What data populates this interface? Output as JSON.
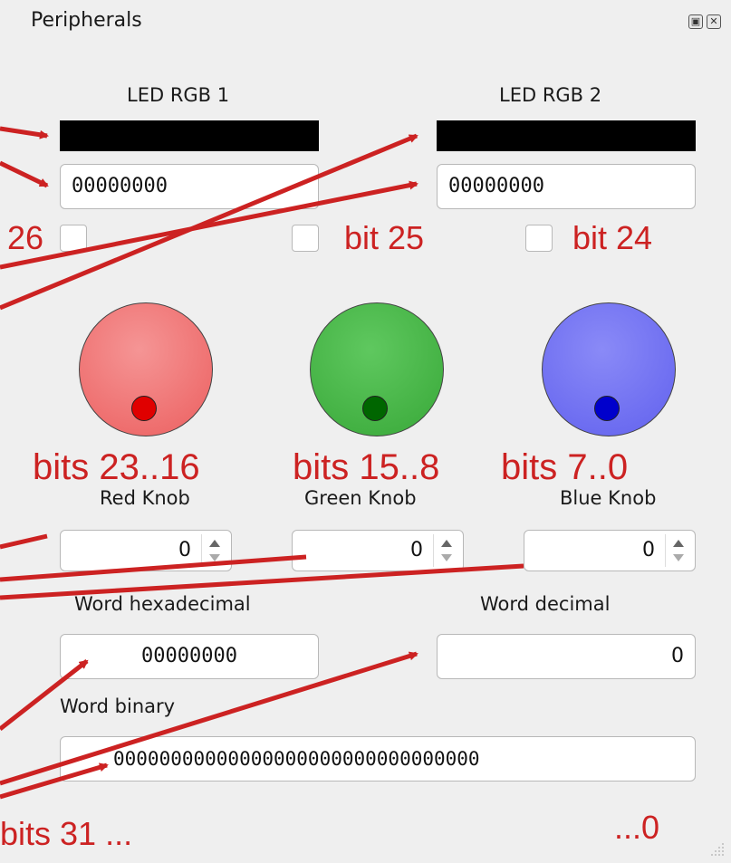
{
  "window": {
    "title": "Peripherals",
    "float_icon": "float-icon",
    "close_icon": "close-icon"
  },
  "leds": [
    {
      "label": "LED RGB 1",
      "value": "00000000",
      "color": "#000000"
    },
    {
      "label": "LED RGB 2",
      "value": "00000000",
      "color": "#000000"
    }
  ],
  "bit_annotations": {
    "bit26": "26",
    "bit25": "bit 25",
    "bit24": "bit 24"
  },
  "knobs": [
    {
      "annotation": "bits 23..16",
      "label": "Red Knob",
      "value": "0",
      "color": "#f26c6c",
      "dot": "#e00000"
    },
    {
      "annotation": "bits 15..8",
      "label": "Green Knob",
      "value": "0",
      "color": "#3fb03f",
      "dot": "#006600"
    },
    {
      "annotation": "bits 7..0",
      "label": "Blue Knob",
      "value": "0",
      "color": "#6f6ff2",
      "dot": "#0000cc"
    }
  ],
  "word": {
    "hex_label": "Word hexadecimal",
    "hex_value": "00000000",
    "dec_label": "Word decimal",
    "dec_value": "0",
    "bin_label": "Word binary",
    "bin_value": "00000000000000000000000000000000"
  },
  "footer_annotations": {
    "left": "bits  31 ...",
    "right": "...0"
  },
  "annotation_color": "#cc2222"
}
